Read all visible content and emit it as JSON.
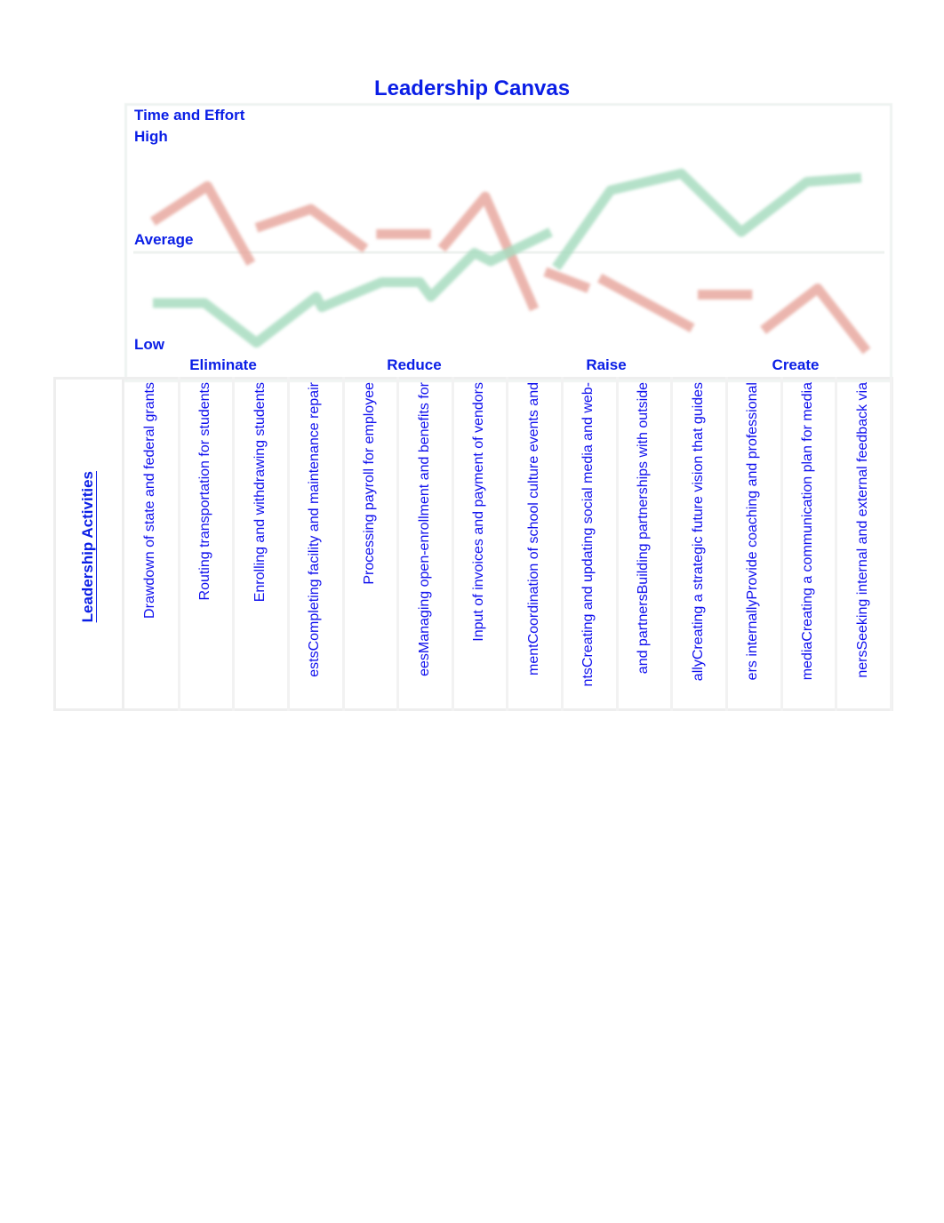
{
  "chart_data": {
    "type": "line",
    "title": "Leadership Canvas",
    "ylabel": "Time and Effort",
    "y_tick_labels": [
      "Low",
      "Average",
      "High"
    ],
    "ylim": [
      0,
      10
    ],
    "grid": "horizontal line at Average",
    "legend": "none",
    "category_groups": [
      "Eliminate",
      "Reduce",
      "Raise",
      "Create"
    ],
    "categories": [
      "Drawdown of state and federal grants",
      "Routing transportation for students",
      "Enrolling and withdrawing students",
      "estsCompleting facility and maintenance repair",
      "Processing payroll for employee",
      "eesManaging open-enrollment and benefits for",
      "Input of invoices and payment of vendors",
      "mentCoordination of school culture events and",
      "ntsCreating and updating social media and web-",
      "and partnersBuilding partnerships with outside",
      "allyCreating a strategic future vision that guides",
      "ers internallyProvide coaching and professional",
      "mediaCreating a communication plan for media",
      "nersSeeking internal and external feedback via"
    ],
    "row_header": "Leadership Activities",
    "series": [
      {
        "color": "#e8a9a0",
        "segments": [
          [
            [
              0,
              6.2
            ],
            [
              1,
              7.9
            ],
            [
              1.8,
              4.2
            ]
          ],
          [
            [
              1.9,
              5.9
            ],
            [
              2.9,
              6.8
            ],
            [
              3.9,
              4.9
            ]
          ],
          [
            [
              4.1,
              5.6
            ],
            [
              5.1,
              5.6
            ]
          ],
          [
            [
              5.3,
              4.9
            ],
            [
              6.1,
              7.4
            ],
            [
              7.0,
              2.0
            ]
          ],
          [
            [
              7.2,
              3.8
            ],
            [
              8.0,
              3.0
            ]
          ],
          [
            [
              8.2,
              3.5
            ],
            [
              9.9,
              1.1
            ]
          ],
          [
            [
              10.0,
              2.7
            ],
            [
              11.0,
              2.7
            ]
          ],
          [
            [
              11.2,
              1.0
            ],
            [
              12.2,
              3.0
            ],
            [
              13.1,
              0
            ]
          ]
        ]
      },
      {
        "color": "#a8dcc0",
        "segments": [
          [
            [
              0,
              2.3
            ],
            [
              0.95,
              2.3
            ],
            [
              1.9,
              0.4
            ],
            [
              3,
              2.6
            ],
            [
              3.1,
              2.1
            ],
            [
              4.2,
              3.3
            ],
            [
              4.9,
              3.3
            ],
            [
              5.1,
              2.6
            ],
            [
              5.9,
              4.7
            ],
            [
              6.2,
              4.3
            ],
            [
              7.3,
              5.7
            ]
          ],
          [
            [
              7.4,
              4.0
            ],
            [
              8.4,
              7.7
            ],
            [
              9.7,
              8.5
            ],
            [
              10.8,
              5.7
            ],
            [
              12,
              8.1
            ],
            [
              13,
              8.3
            ]
          ]
        ]
      }
    ]
  }
}
